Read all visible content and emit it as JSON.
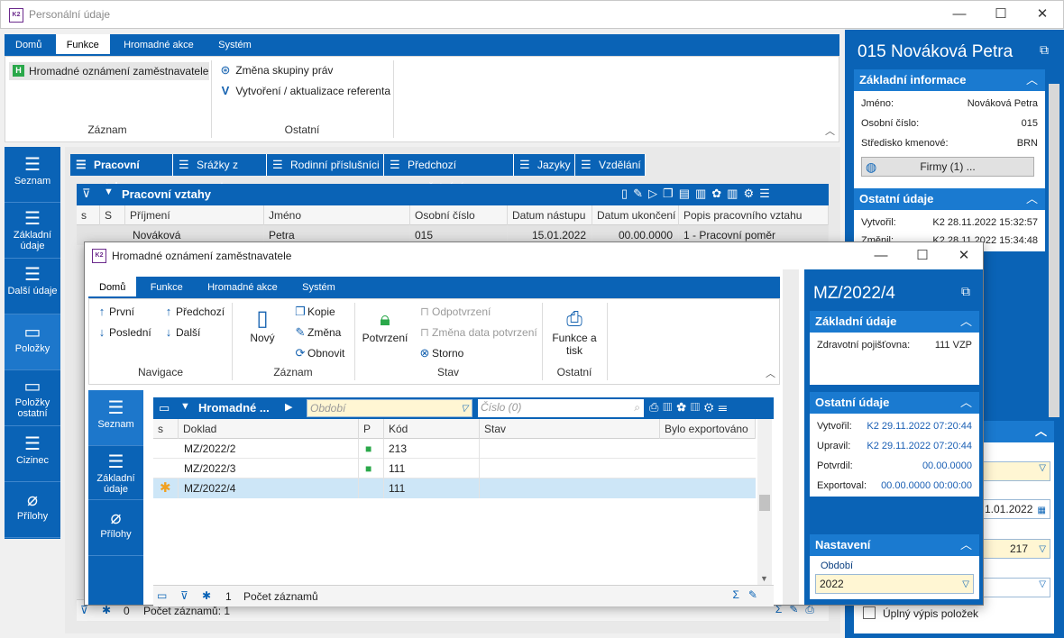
{
  "main_window": {
    "title": "Personální údaje",
    "menu_tabs": [
      "Domů",
      "Funkce",
      "Hromadné akce",
      "Systém"
    ],
    "ribbon": {
      "zaznam": {
        "btn1": "Hromadné oznámení zaměstnavatele",
        "label": "Záznam"
      },
      "ostatni": {
        "btn1": "Změna skupiny práv",
        "btn2": "Vytvoření / aktualizace referenta",
        "label": "Ostatní"
      }
    },
    "nav": [
      "Seznam",
      "Základní údaje",
      "Další údaje",
      "Položky",
      "Položky ostatní",
      "Cizinec",
      "Přílohy"
    ],
    "page_tabs": [
      "Pracovní vztahy",
      "Srážky z mezd",
      "Rodinní příslušníci",
      "Předchozí zaměstnání",
      "Jazyky",
      "Vzdělání"
    ],
    "grid_title": "Pracovní vztahy",
    "columns": [
      "s",
      "S",
      "Příjmení",
      "Jméno",
      "Osobní číslo",
      "Datum nástupu",
      "Datum ukončení",
      "Popis pracovního vztahu"
    ],
    "row": [
      "Nováková",
      "Petra",
      "015",
      "15.01.2022",
      "00.00.0000",
      "1 - Pracovní poměr"
    ],
    "status": {
      "count": "0",
      "label": "Počet záznamů: 1"
    }
  },
  "right_panel": {
    "title": "015 Nováková Petra",
    "basic_title": "Základní informace",
    "basic": [
      {
        "label": "Jméno:",
        "value": "Nováková Petra"
      },
      {
        "label": "Osobní číslo:",
        "value": "015"
      },
      {
        "label": "Středisko kmenové:",
        "value": "BRN"
      }
    ],
    "firms_button": "Firmy (1) ...",
    "other_title": "Ostatní údaje",
    "created_label": "Vytvořil:",
    "created_value": "K2 28.11.2022 15:32:57",
    "changed_label": "Změnil:",
    "changed_value": "K2 28.11.2022 15:34:48",
    "date_value": "1.01.2022",
    "num_value": "217",
    "checkbox_label": "Úplný výpis položek"
  },
  "dialog": {
    "title": "Hromadné oznámení zaměstnavatele",
    "menu_tabs": [
      "Domů",
      "Funkce",
      "Hromadné akce",
      "Systém"
    ],
    "navigace": {
      "prvni": "První",
      "posledni": "Poslední",
      "predchozi": "Předchozí",
      "dalsi": "Další",
      "label": "Navigace"
    },
    "zaznam": {
      "novy": "Nový",
      "kopie": "Kopie",
      "zmena": "Změna",
      "obnovit": "Obnovit",
      "label": "Záznam"
    },
    "stav": {
      "potvrzeni": "Potvrzení",
      "odpotvrzeni": "Odpotvrzení",
      "zmena_data": "Změna data potvrzení",
      "storno": "Storno",
      "label": "Stav"
    },
    "ostatni": {
      "funkce_tisk": "Funkce a tisk",
      "label": "Ostatní"
    },
    "nav": [
      "Seznam",
      "Základní údaje",
      "Přílohy"
    ],
    "grid_title": "Hromadné ...",
    "obdobi_placeholder": "Období",
    "cislo_placeholder": "Číslo (0)",
    "columns": [
      "s",
      "Doklad",
      "P",
      "Kód",
      "Stav",
      "Bylo exportováno"
    ],
    "rows": [
      {
        "doklad": "MZ/2022/2",
        "locked": true,
        "kod": "213"
      },
      {
        "doklad": "MZ/2022/3",
        "locked": true,
        "kod": "111"
      },
      {
        "doklad": "MZ/2022/4",
        "locked": false,
        "kod": "111"
      }
    ],
    "status": {
      "count": "1",
      "label": "Počet záznamů"
    },
    "right": {
      "title": "MZ/2022/4",
      "basic_title": "Základní údaje",
      "zp_label": "Zdravotní pojišťovna:",
      "zp_value": "111 VZP",
      "other_title": "Ostatní údaje",
      "other": [
        {
          "label": "Vytvořil:",
          "value": "K2 29.11.2022 07:20:44"
        },
        {
          "label": "Upravil:",
          "value": "K2 29.11.2022 07:20:44"
        },
        {
          "label": "Potvrdil:",
          "value": "00.00.0000"
        },
        {
          "label": "Exportoval:",
          "value": "00.00.0000 00:00:00"
        }
      ],
      "settings_title": "Nastavení",
      "obdobi_label": "Období",
      "obdobi_value": "2022"
    }
  },
  "colors": {
    "accent": "#0a63b6",
    "section": "#1a7ad0",
    "selected_row": "#cde6f7",
    "input_bg": "#fff6d3"
  }
}
